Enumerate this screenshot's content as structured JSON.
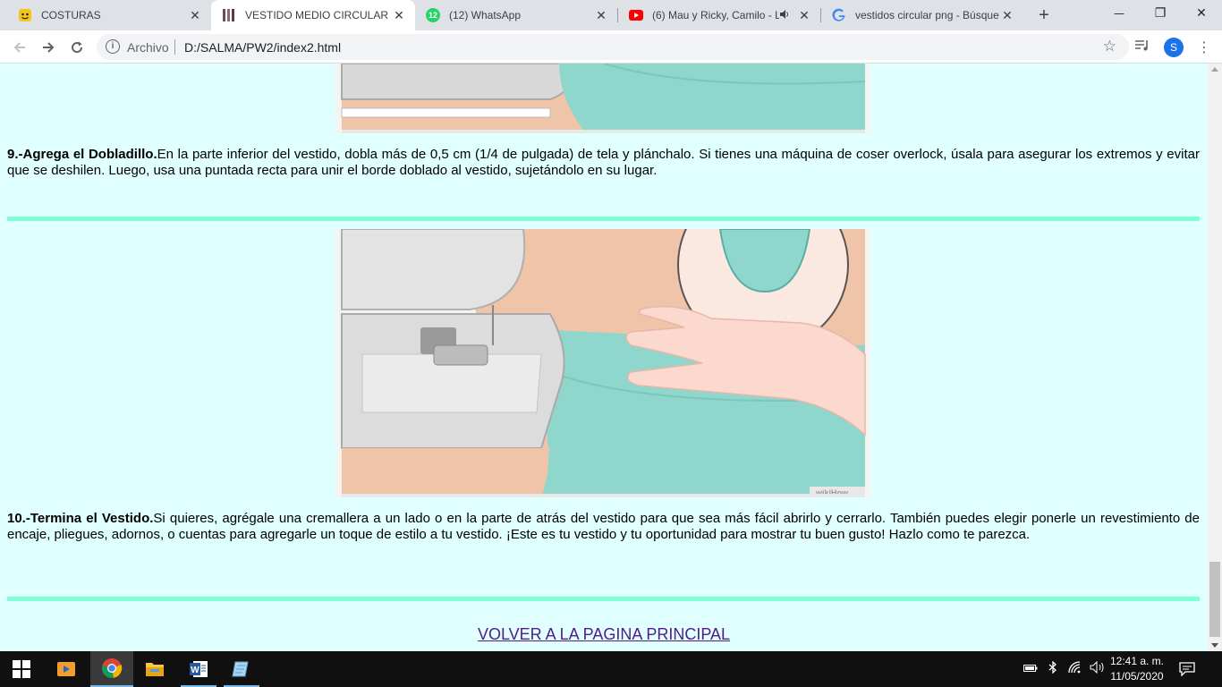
{
  "browser": {
    "tabs": [
      {
        "title": "COSTURAS",
        "favicon": "lego-favicon-icon",
        "active": false
      },
      {
        "title": "VESTIDO MEDIO CIRCULAR",
        "favicon": "dress-favicon-icon",
        "active": true
      },
      {
        "title": "(12) WhatsApp",
        "favicon": "whatsapp-favicon-icon",
        "badge": "12",
        "active": false
      },
      {
        "title": "(6) Mau y Ricky, Camilo - L",
        "favicon": "youtube-favicon-icon",
        "audio": true,
        "active": false
      },
      {
        "title": "vestidos circular png - Búsque",
        "favicon": "google-favicon-icon",
        "active": false
      }
    ],
    "new_tab_label": "+",
    "window_controls": {
      "minimize": "—",
      "restore": "❐",
      "close": "✕"
    },
    "address": {
      "scheme_label": "Archivo",
      "url": "D:/SALMA/PW2/index2.html"
    },
    "profile_initial": "S"
  },
  "page": {
    "background": "#e0ffff",
    "rule_color": "#7fffd4",
    "step9": {
      "title": "9.-Agrega el Dobladillo.",
      "text": "En la parte inferior del vestido, dobla más de 0,5 cm (1/4 de pulgada) de tela y plánchalo. Si tienes una máquina de coser overlock, úsala para asegurar los extremos y evitar que se deshilen. Luego, usa una puntada recta para unir el borde doblado al vestido, sujetándolo en su lugar."
    },
    "step10": {
      "title": "10.-Termina el Vestido.",
      "text": "Si quieres, agrégale una cremallera a un lado o en la parte de atrás del vestido para que sea más fácil abrirlo y cerrarlo. También puedes elegir ponerle un revestimiento de encaje, pliegues, adornos, o cuentas para agregarle un toque de estilo a tu vestido. ¡Este es tu vestido y tu oportunidad para mostrar tu buen gusto! Hazlo como te parezca."
    },
    "back_link": "VOLVER A LA PAGINA PRINCIPAL",
    "watermark": "wikiHow"
  },
  "taskbar": {
    "apps": [
      "windows-start-icon",
      "media-player-icon",
      "chrome-icon",
      "file-explorer-icon",
      "word-icon",
      "notepad-app-icon"
    ],
    "clock_time": "12:41 a. m.",
    "clock_date": "11/05/2020"
  }
}
